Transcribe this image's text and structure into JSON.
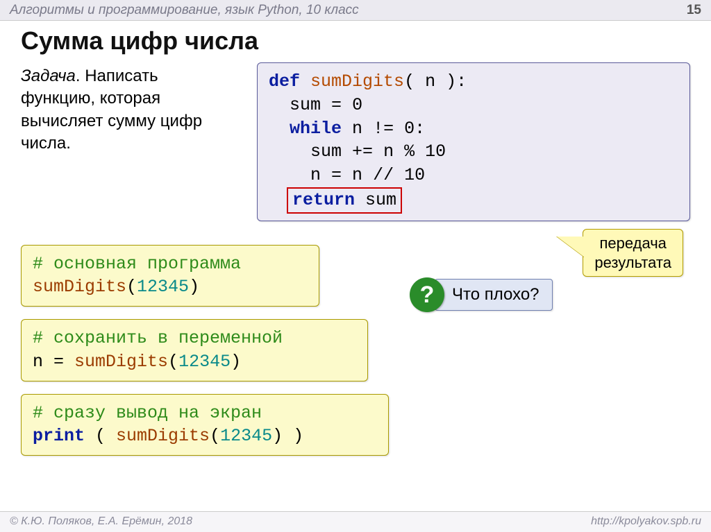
{
  "header": {
    "subject": "Алгоритмы и программирование, язык Python, 10 класс",
    "page": "15"
  },
  "title": "Сумма цифр числа",
  "task": {
    "label": "Задача",
    "body": ". Написать функцию, которая вычисляет сумму цифр числа."
  },
  "code": {
    "l1_def": "def",
    "l1_fn": "sumDigits",
    "l1_rest": "( n ):",
    "l2": "  sum",
    "l2_eq": "=",
    "l2_zero": "0",
    "l3_while": "  while",
    "l3_rest": " n",
    "l3_ne": "!=",
    "l3_zero": "0:",
    "l4": "    sum",
    "l4_pe": "+=",
    "l4_rest": " n",
    "l4_mod": "%",
    "l4_ten": "10",
    "l5": "    n",
    "l5_eq": "=",
    "l5_rest": " n",
    "l5_fd": "//",
    "l5_ten": "10",
    "l6_ret": "return",
    "l6_sum": " sum"
  },
  "callout": {
    "line1": "передача",
    "line2": "результата"
  },
  "snippets": {
    "a_comment": "# основная программа",
    "a_fn": "sumDigits",
    "a_open": "(",
    "a_arg": "12345",
    "a_close": ")",
    "b_comment": "# сохранить в переменной",
    "b_lhs": "n = ",
    "b_fn": "sumDigits",
    "b_open": "(",
    "b_arg": "12345",
    "b_close": ")",
    "c_comment": "# сразу вывод на экран",
    "c_print": "print",
    "c_space": " ( ",
    "c_fn": "sumDigits",
    "c_open": "(",
    "c_arg": "12345",
    "c_close": ") )"
  },
  "question": {
    "mark": "?",
    "text": "Что плохо?"
  },
  "footer": {
    "left": "© К.Ю. Поляков, Е.А. Ерёмин, 2018",
    "right": "http://kpolyakov.spb.ru"
  }
}
